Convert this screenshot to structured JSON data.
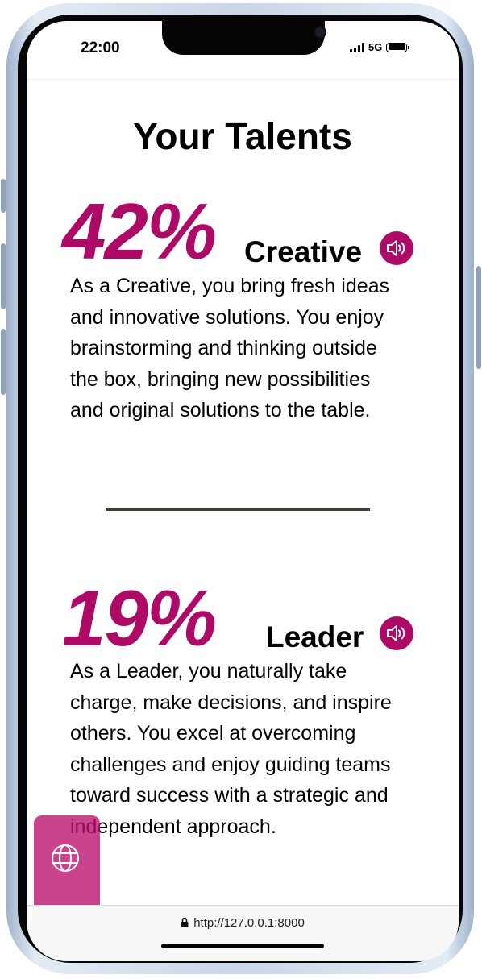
{
  "status_bar": {
    "time": "22:00",
    "network": "5G"
  },
  "page": {
    "title": "Your Talents"
  },
  "talents": [
    {
      "percent": "42%",
      "name": "Creative",
      "description": "As a Creative, you bring fresh ideas and innovative solutions. You enjoy brainstorming and thinking outside the box, bringing new possibilities and original solutions to the table.",
      "icon": "speaker-icon"
    },
    {
      "percent": "19%",
      "name": "Leader",
      "description": "As a Leader, you naturally take charge, make decisions, and inspire others. You excel at overcoming challenges and enjoy guiding teams toward success with a strategic and independent approach.",
      "icon": "speaker-icon"
    }
  ],
  "browser": {
    "url": "http://127.0.0.1:8000"
  },
  "colors": {
    "accent": "#ad0a68",
    "divider": "#3a4230",
    "fab": "#ba106c"
  }
}
